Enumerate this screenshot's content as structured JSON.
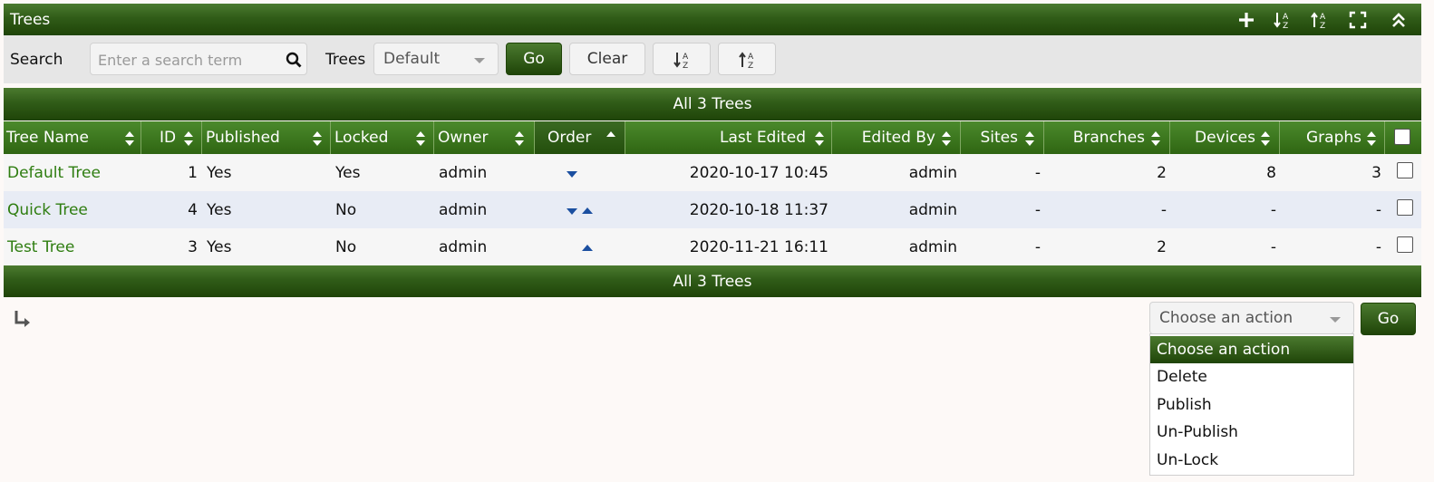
{
  "header": {
    "title": "Trees",
    "icons": [
      "plus-icon",
      "sort-asc-icon",
      "sort-desc-icon",
      "fullscreen-icon",
      "collapse-icon"
    ]
  },
  "filter": {
    "search_label": "Search",
    "search_placeholder": "Enter a search term",
    "trees_label": "Trees",
    "trees_value": "Default",
    "go_label": "Go",
    "clear_label": "Clear"
  },
  "nav": {
    "top": "All 3 Trees",
    "bottom": "All 3 Trees"
  },
  "columns": [
    "Tree Name",
    "ID",
    "Published",
    "Locked",
    "Owner",
    "Order",
    "Last Edited",
    "Edited By",
    "Sites",
    "Branches",
    "Devices",
    "Graphs"
  ],
  "rows": [
    {
      "name": "Default Tree",
      "id": "1",
      "published": "Yes",
      "locked": "Yes",
      "owner": "admin",
      "order": [
        "down"
      ],
      "last_edited": "2020-10-17 10:45",
      "edited_by": "admin",
      "sites": "-",
      "branches": "2",
      "devices": "8",
      "graphs": "3"
    },
    {
      "name": "Quick Tree",
      "id": "4",
      "published": "Yes",
      "locked": "No",
      "owner": "admin",
      "order": [
        "down",
        "up"
      ],
      "last_edited": "2020-10-18 11:37",
      "edited_by": "admin",
      "sites": "-",
      "branches": "-",
      "devices": "-",
      "graphs": "-"
    },
    {
      "name": "Test Tree",
      "id": "3",
      "published": "Yes",
      "locked": "No",
      "owner": "admin",
      "order": [
        "up"
      ],
      "last_edited": "2020-11-21 16:11",
      "edited_by": "admin",
      "sites": "-",
      "branches": "2",
      "devices": "-",
      "graphs": "-"
    }
  ],
  "actions": {
    "select_value": "Choose an action",
    "go_label": "Go",
    "options": [
      "Choose an action",
      "Delete",
      "Publish",
      "Un-Publish",
      "Un-Lock"
    ]
  },
  "colors": {
    "brand_green": "#305c18",
    "link_green": "#2e7d10",
    "order_arrow": "#1b4fa0"
  }
}
